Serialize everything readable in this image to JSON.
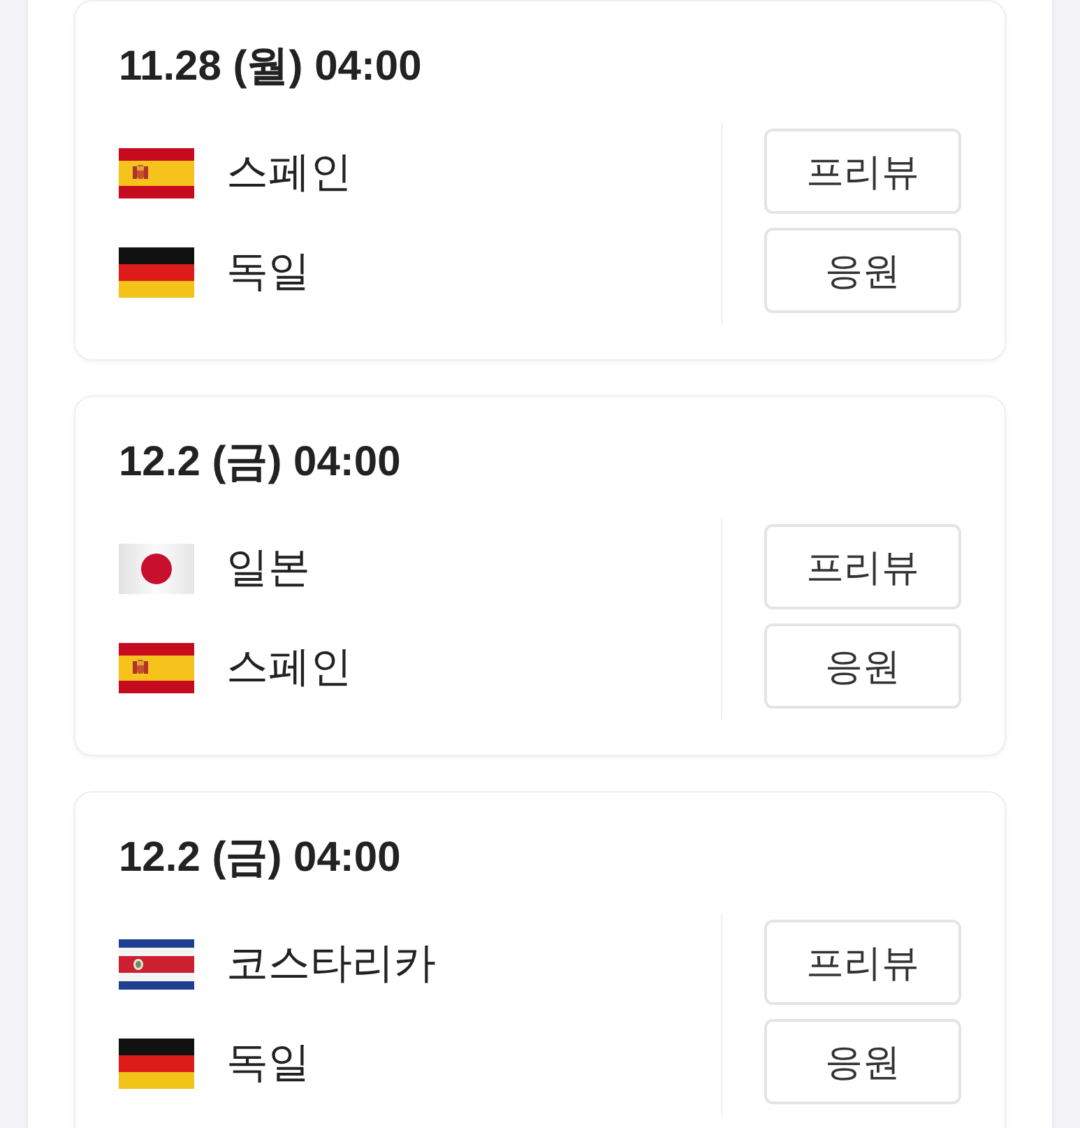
{
  "matches": [
    {
      "datetime": "11.28 (월) 04:00",
      "teams": [
        {
          "name": "스페인",
          "kind": "spain"
        },
        {
          "name": "독일",
          "kind": "germany"
        }
      ],
      "buttons": [
        "프리뷰",
        "응원"
      ]
    },
    {
      "datetime": "12.2 (금) 04:00",
      "teams": [
        {
          "name": "일본",
          "kind": "japan"
        },
        {
          "name": "스페인",
          "kind": "spain"
        }
      ],
      "buttons": [
        "프리뷰",
        "응원"
      ]
    },
    {
      "datetime": "12.2 (금) 04:00",
      "teams": [
        {
          "name": "코스타리카",
          "kind": "costa-rica"
        },
        {
          "name": "독일",
          "kind": "germany"
        }
      ],
      "buttons": [
        "프리뷰",
        "응원"
      ]
    }
  ]
}
